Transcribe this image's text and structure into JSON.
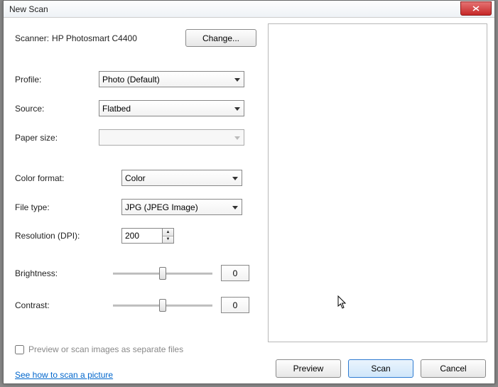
{
  "title": "New Scan",
  "scanner": {
    "label": "Scanner:",
    "name": "HP Photosmart C4400",
    "change": "Change..."
  },
  "profile": {
    "label": "Profile:",
    "value": "Photo (Default)"
  },
  "source": {
    "label": "Source:",
    "value": "Flatbed"
  },
  "paper": {
    "label": "Paper size:",
    "value": ""
  },
  "colorfmt": {
    "label": "Color format:",
    "value": "Color"
  },
  "filetype": {
    "label": "File type:",
    "value": "JPG (JPEG Image)"
  },
  "resolution": {
    "label": "Resolution (DPI):",
    "value": "200"
  },
  "brightness": {
    "label": "Brightness:",
    "value": "0"
  },
  "contrast": {
    "label": "Contrast:",
    "value": "0"
  },
  "checkbox": {
    "label": "Preview or scan images as separate files"
  },
  "link": "See how to scan a picture",
  "buttons": {
    "preview": "Preview",
    "scan": "Scan",
    "cancel": "Cancel"
  }
}
